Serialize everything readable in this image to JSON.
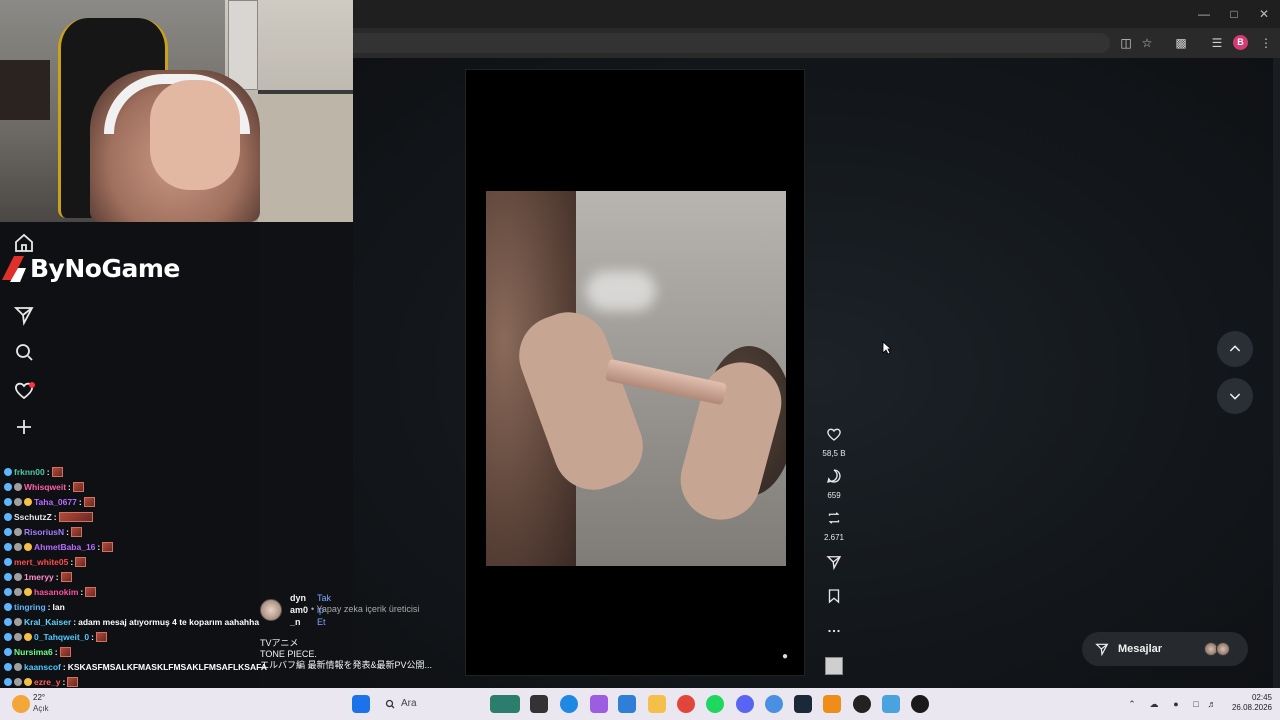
{
  "browser": {
    "window_controls": [
      "minimize",
      "maximize",
      "close"
    ],
    "profile_initial": "B"
  },
  "sidebar": {
    "logo": "ByNoGame",
    "icons": [
      "home-icon",
      "send-icon",
      "search-icon",
      "heart-icon",
      "plus-icon"
    ]
  },
  "chat": {
    "lines": [
      {
        "user": "frknn00",
        "color": "#4ec9a6",
        "sep": " :",
        "msg": "",
        "emote": true
      },
      {
        "user": "Whisqweit",
        "color": "#ff5fa8",
        "sep": " :",
        "msg": "",
        "emote": true
      },
      {
        "user": "Taha_0677",
        "color": "#b86cff",
        "sep": " :",
        "msg": "",
        "emote": true
      },
      {
        "user": "SschutzZ",
        "color": "#e8e8e8",
        "sep": " :",
        "msg": "",
        "emote": true,
        "wide": true
      },
      {
        "user": "RisoriusN",
        "color": "#a57bff",
        "sep": " :",
        "msg": "",
        "emote": true
      },
      {
        "user": "AhmetBaba_16",
        "color": "#b86cff",
        "sep": " :",
        "msg": "",
        "emote": true
      },
      {
        "user": "mert_white05",
        "color": "#ff4a4a",
        "sep": " :",
        "msg": "",
        "emote": true
      },
      {
        "user": "1meryy",
        "color": "#ff8fc8",
        "sep": " :",
        "msg": "",
        "emote": true
      },
      {
        "user": "hasanokim",
        "color": "#ff4fa0",
        "sep": " :",
        "msg": "",
        "emote": true
      },
      {
        "user": "tingring",
        "color": "#5fb6ff",
        "sep": " :",
        "msg": " lan",
        "emote": false
      },
      {
        "user": "Kral_Kaiser",
        "color": "#5fd3ff",
        "sep": " :",
        "msg": " adam mesaj atıyormuş 4 te koparım aahahha",
        "emote": false
      },
      {
        "user": "0_Tahqweit_0",
        "color": "#4ec9ff",
        "sep": " :",
        "msg": "",
        "emote": true
      },
      {
        "user": "Nursima6",
        "color": "#6bff8a",
        "sep": " :",
        "msg": "",
        "emote": true
      },
      {
        "user": "kaanscof",
        "color": "#4ec9ff",
        "sep": " :",
        "msg": " KSKASFMSALKFMASKLFMSAKLFMSAFLKSAFA",
        "emote": false
      },
      {
        "user": "ezre_y",
        "color": "#ff5f5f",
        "sep": " :",
        "msg": "",
        "emote": true
      }
    ]
  },
  "post": {
    "author": "dynam0_n",
    "follow_label": "Takip Et",
    "ai_label": "• Yapay zeka içerik üreticisi",
    "caption_lines": [
      "TVアニメ",
      "TONE PIECE.",
      "エルバフ編 最新情報を発表&最新PV公開..."
    ]
  },
  "actions": {
    "likes": "58,5 B",
    "comments": "659",
    "reposts": "2.671"
  },
  "messages": {
    "label": "Mesajlar"
  },
  "taskbar": {
    "search_placeholder": "Ara",
    "weather_temp": "22°",
    "weather_desc": "Açık",
    "time": "02:45",
    "date": "26.08.2026"
  }
}
